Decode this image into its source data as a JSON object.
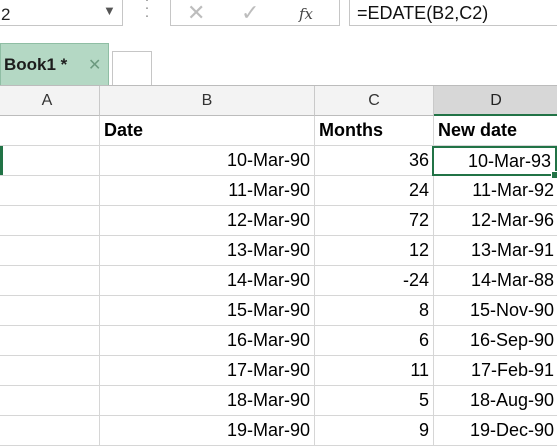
{
  "name_box": {
    "value": "2",
    "dropdown_icon": "triangle-down"
  },
  "formula_bar": {
    "cancel_icon": "x-mark",
    "enter_icon": "check-mark",
    "fx_label": "fx",
    "formula": "=EDATE(B2,C2)"
  },
  "workbook_tab": {
    "label": "Book1 *",
    "close_icon": "x-mark"
  },
  "columns": [
    "A",
    "B",
    "C",
    "D"
  ],
  "header_row": {
    "date": "Date",
    "months": "Months",
    "new_date": "New date"
  },
  "rows": [
    {
      "date": "10-Mar-90",
      "months": "36",
      "new_date": "10-Mar-93"
    },
    {
      "date": "11-Mar-90",
      "months": "24",
      "new_date": "11-Mar-92"
    },
    {
      "date": "12-Mar-90",
      "months": "72",
      "new_date": "12-Mar-96"
    },
    {
      "date": "13-Mar-90",
      "months": "12",
      "new_date": "13-Mar-91"
    },
    {
      "date": "14-Mar-90",
      "months": "-24",
      "new_date": "14-Mar-88"
    },
    {
      "date": "15-Mar-90",
      "months": "8",
      "new_date": "15-Nov-90"
    },
    {
      "date": "16-Mar-90",
      "months": "6",
      "new_date": "16-Sep-90"
    },
    {
      "date": "17-Mar-90",
      "months": "11",
      "new_date": "17-Feb-91"
    },
    {
      "date": "18-Mar-90",
      "months": "5",
      "new_date": "18-Aug-90"
    },
    {
      "date": "19-Mar-90",
      "months": "9",
      "new_date": "19-Dec-90"
    }
  ],
  "colors": {
    "accent": "#217346",
    "tab_fill": "#b4d8c4"
  }
}
